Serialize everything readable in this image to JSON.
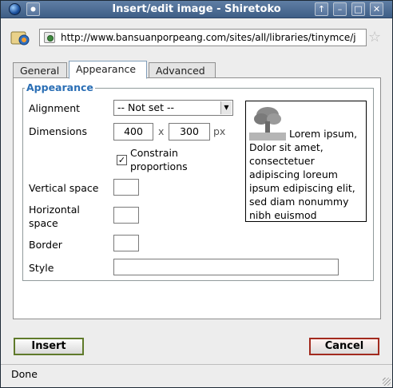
{
  "window": {
    "title": "Insert/edit image - Shiretoko",
    "controls": {
      "up": "↑",
      "minimize": "–",
      "maximize": "□",
      "close": "✕"
    }
  },
  "urlbar": {
    "url": "http://www.bansuanporpeang.com/sites/all/libraries/tinymce/j"
  },
  "tabs": [
    {
      "label": "General",
      "active": false
    },
    {
      "label": "Appearance",
      "active": true
    },
    {
      "label": "Advanced",
      "active": false
    }
  ],
  "appearance": {
    "legend": "Appearance",
    "alignment": {
      "label": "Alignment",
      "value": "-- Not set --"
    },
    "dimensions": {
      "label": "Dimensions",
      "width": "400",
      "height": "300",
      "separator": "x",
      "unit": "px"
    },
    "constrain": {
      "label_line1": "Constrain",
      "label_line2": "proportions",
      "checked": true
    },
    "vertical_space": {
      "label": "Vertical space",
      "value": ""
    },
    "horizontal_space": {
      "label_line1": "Horizontal",
      "label_line2": "space",
      "value": ""
    },
    "border": {
      "label": "Border",
      "value": ""
    },
    "style": {
      "label": "Style",
      "value": ""
    },
    "preview_text": "Lorem ipsum, Dolor sit amet, consectetuer adipiscing loreum ipsum edipiscing elit, sed diam nonummy nibh euismod"
  },
  "buttons": {
    "insert": "Insert",
    "cancel": "Cancel"
  },
  "status": "Done",
  "colors": {
    "titlebar": "#4a6b94",
    "legend": "#2b6fb5",
    "insert_border": "#5f7a2a",
    "cancel_border": "#a22a1e"
  }
}
